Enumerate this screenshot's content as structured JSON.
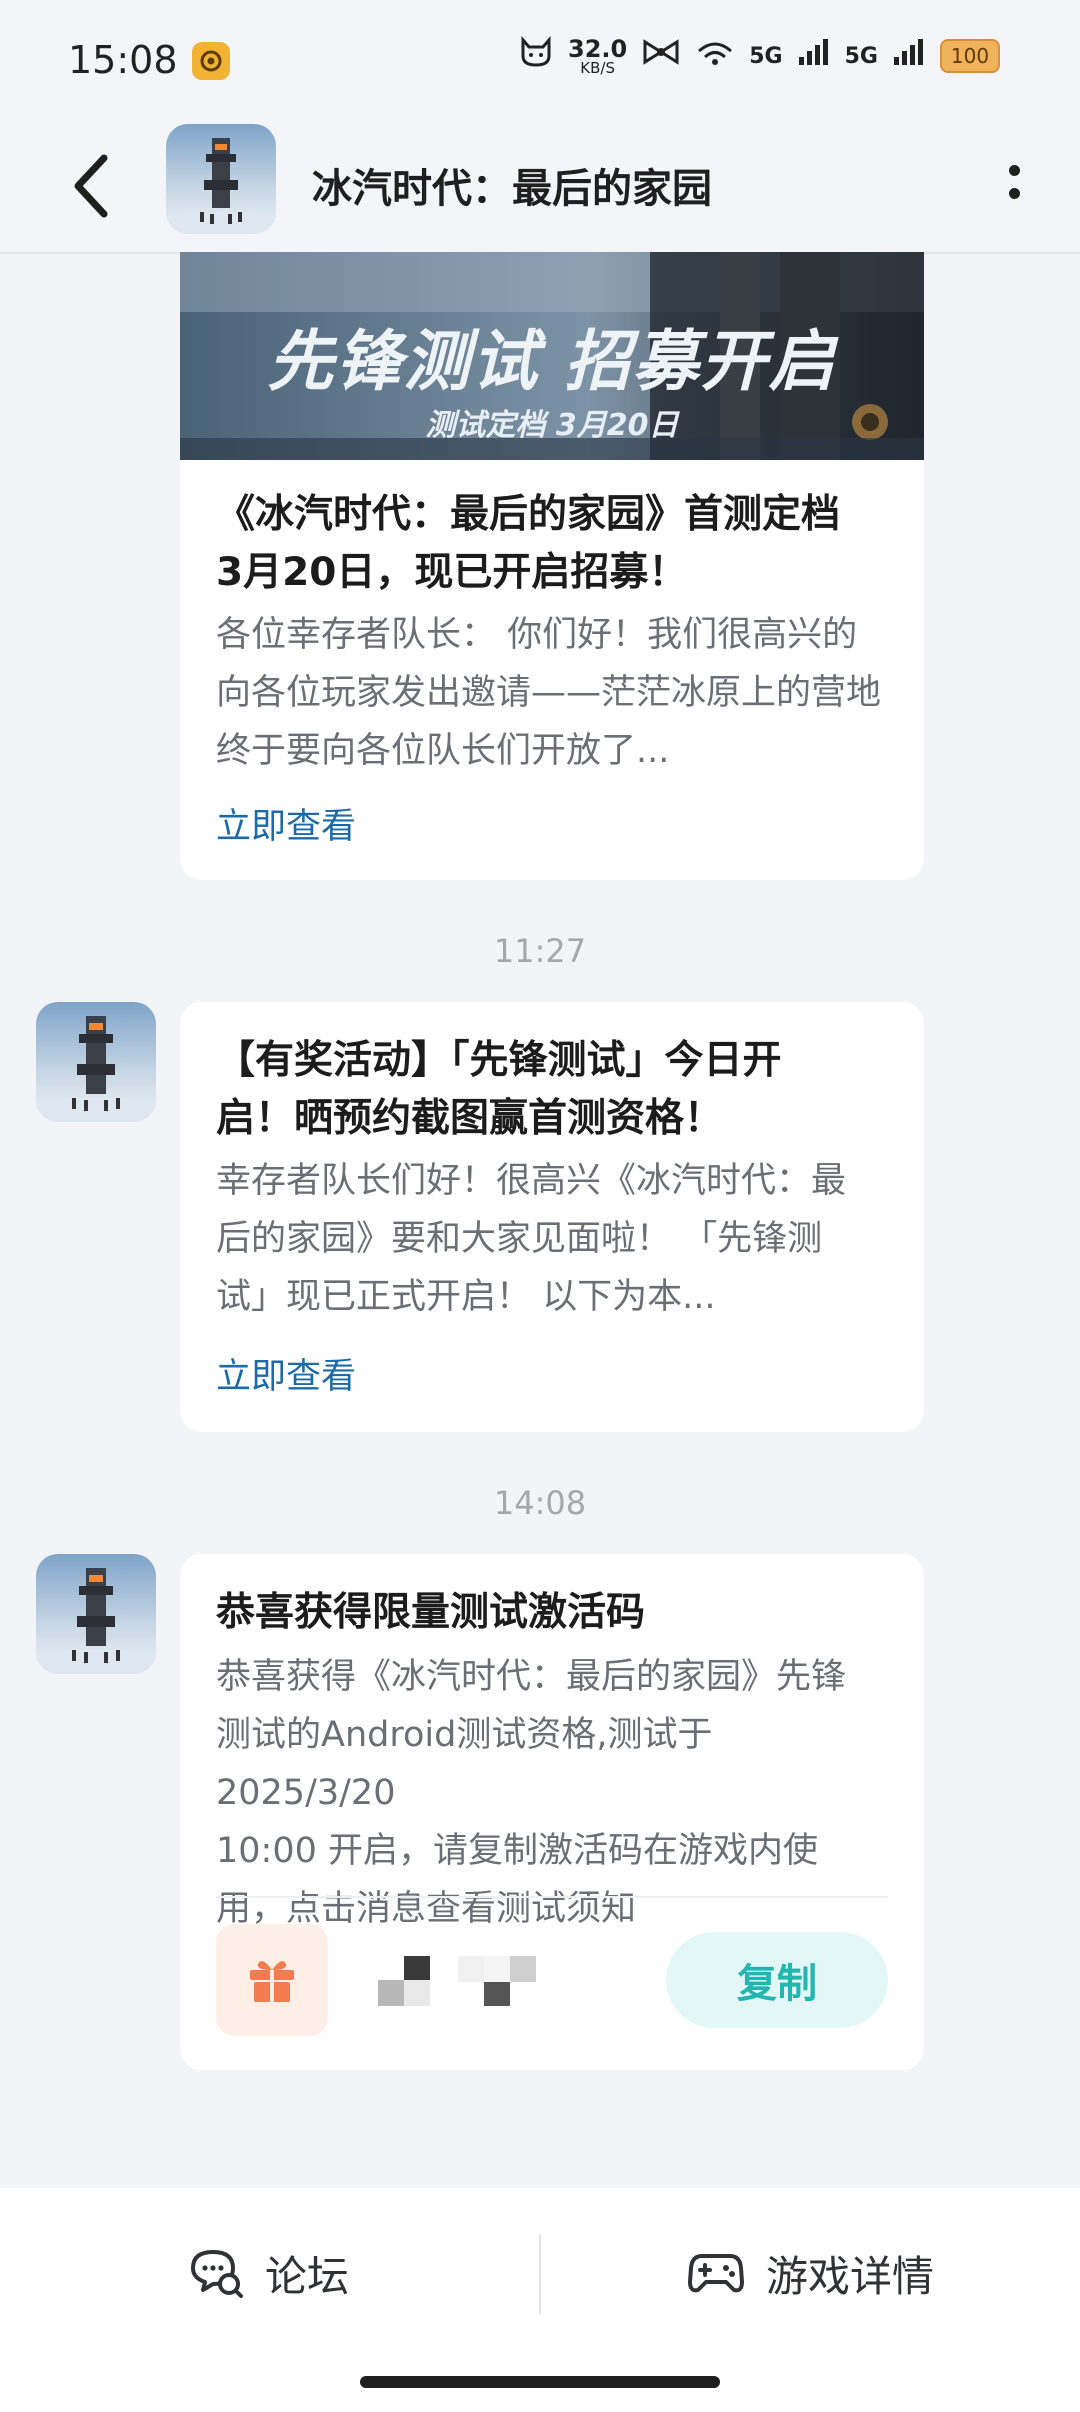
{
  "status_bar": {
    "time": "15:08",
    "net_speed_value": "32.0",
    "net_speed_unit": "KB/S",
    "signal_1": "5G",
    "signal_2": "5G",
    "battery": "100"
  },
  "header": {
    "title": "冰汽时代：最后的家园"
  },
  "messages": [
    {
      "banner_headline": "先锋测试 招募开启",
      "banner_sub": "测试定档 3月20日",
      "title_lines": [
        "《冰汽时代：最后的家园》首测定档",
        "3月20日，现已开启招募！"
      ],
      "body_lines": [
        "各位幸存者队长： 你们好！我们很高兴的",
        "向各位玩家发出邀请——茫茫冰原上的营地",
        "终于要向各位队长们开放了..."
      ],
      "link": "立即查看"
    },
    {
      "timestamp": "11:27",
      "title_lines": [
        "【有奖活动】「先锋测试」今日开",
        "启！晒预约截图赢首测资格！"
      ],
      "body_lines": [
        "幸存者队长们好！很高兴《冰汽时代：最",
        "后的家园》要和大家见面啦！ 「先锋测",
        "试」现已正式开启！ 以下为本..."
      ],
      "link": "立即查看"
    },
    {
      "timestamp": "14:08",
      "title_lines": [
        "恭喜获得限量测试激活码"
      ],
      "body_lines": [
        "恭喜获得《冰汽时代：最后的家园》先锋",
        "测试的Android测试资格,测试于 2025/3/20",
        "10:00 开启，请复制激活码在游戏内使",
        "用，点击消息查看测试须知"
      ],
      "copy_label": "复制"
    }
  ],
  "bottom_bar": {
    "forum_label": "论坛",
    "details_label": "游戏详情"
  },
  "colors": {
    "link": "#1c6aa8",
    "copy_text": "#21b7b0",
    "copy_bg": "#e3f7f6",
    "gift": "#f27b4f"
  }
}
